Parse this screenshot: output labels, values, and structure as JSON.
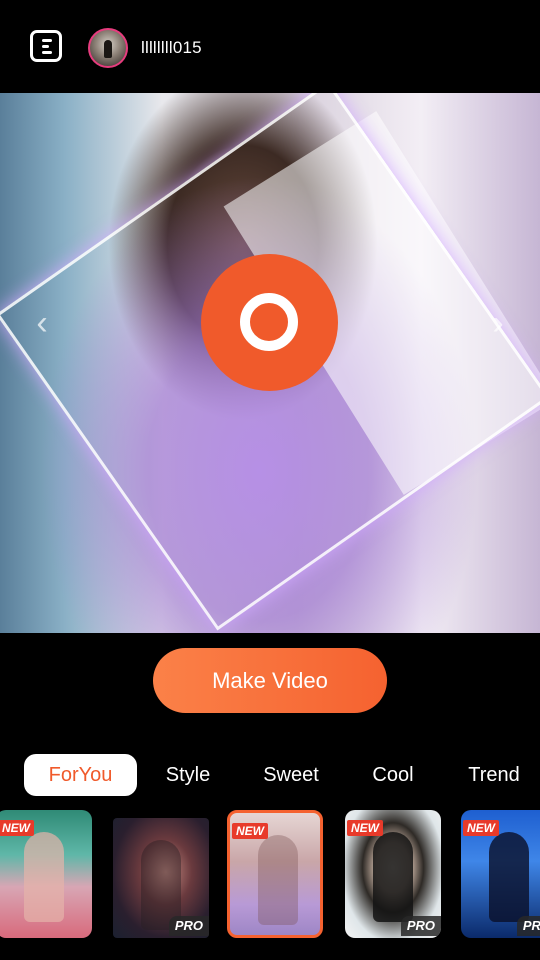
{
  "header": {
    "menu_icon": "menu-list-icon",
    "username": "llllllll015"
  },
  "preview": {
    "prev_icon": "chevron-left-icon",
    "next_icon": "chevron-right-icon",
    "prev_glyph": "‹",
    "next_glyph": "›",
    "record_icon": "record-icon"
  },
  "make_video_label": "Make Video",
  "tabs": [
    {
      "label": "ForYou",
      "active": true
    },
    {
      "label": "Style",
      "active": false
    },
    {
      "label": "Sweet",
      "active": false
    },
    {
      "label": "Cool",
      "active": false
    },
    {
      "label": "Trend",
      "active": false
    }
  ],
  "templates": [
    {
      "badge_new": "NEW",
      "badge_pro": "",
      "selected": false
    },
    {
      "badge_new": "",
      "badge_pro": "PRO",
      "selected": false
    },
    {
      "badge_new": "NEW",
      "badge_pro": "",
      "selected": true
    },
    {
      "badge_new": "NEW",
      "badge_pro": "PRO",
      "selected": false
    },
    {
      "badge_new": "NEW",
      "badge_pro": "PRO",
      "selected": false
    }
  ],
  "colors": {
    "accent": "#f05a2b",
    "button_gradient_start": "#fb8148",
    "button_gradient_end": "#f56230",
    "background": "#000000"
  }
}
